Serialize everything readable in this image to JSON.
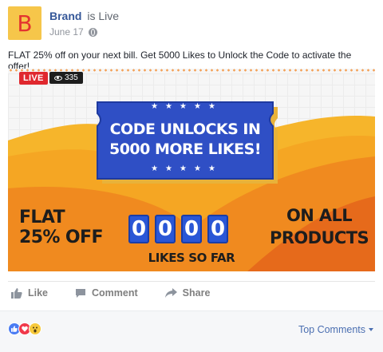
{
  "post": {
    "avatar_letter": "B",
    "page_name": "Brand",
    "status_text": "is Live",
    "date": "June 17",
    "text": "FLAT 25% off on your next bill. Get 5000 Likes to Unlock the Code to activate the offer!"
  },
  "video": {
    "live_label": "LIVE",
    "view_count": "335",
    "banner_line1": "CODE UNLOCKS IN",
    "banner_line2": "5000 MORE LIKES!",
    "stars": "★★★★★",
    "left_line1": "FLAT",
    "left_line2": "25% OFF",
    "right_line1": "ON ALL",
    "right_line2": "PRODUCTS",
    "digits": [
      "0",
      "0",
      "0",
      "0"
    ],
    "likes_caption": "LIKES SO FAR",
    "colors": {
      "banner": "#2f4fc5",
      "ribbon": "#e8b23a",
      "orange": "#f19022",
      "live": "#e0282e"
    }
  },
  "actions": {
    "like": "Like",
    "comment": "Comment",
    "share": "Share"
  },
  "footer": {
    "reaction_icons": [
      "like-reaction",
      "love-reaction",
      "wow-reaction"
    ],
    "top_comments": "Top Comments"
  }
}
